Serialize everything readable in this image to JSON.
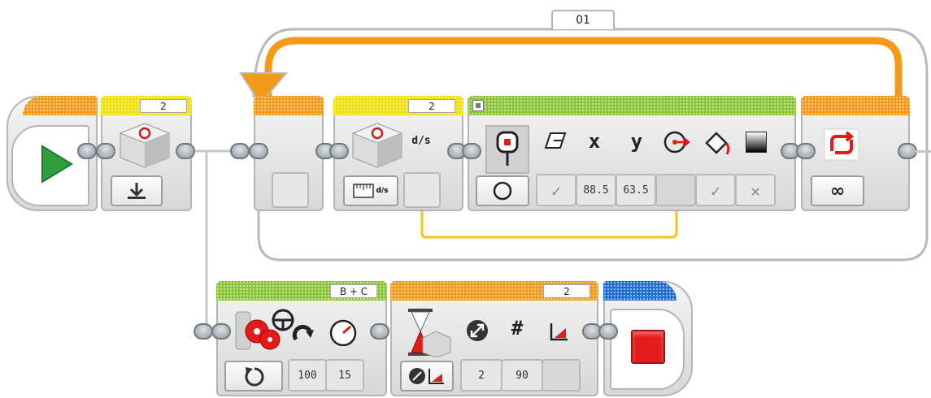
{
  "loop": {
    "name": "01",
    "mode_label": "∞",
    "colors": {
      "header": "#f39a1a",
      "frame": "#b5b5b5",
      "return_arrow": "#f39a1a"
    }
  },
  "timer_reset_block": {
    "port": "2"
  },
  "timer_read_block": {
    "port": "2",
    "unit": "d/s",
    "mode_label": "d/s"
  },
  "display_block": {
    "labels": {
      "x": "x",
      "y": "y"
    },
    "inputs": {
      "clear": "✓",
      "x": "88.5",
      "y": "63.5",
      "fill": "✓",
      "color": "✕"
    },
    "colors": {
      "header": "#8cc43a"
    }
  },
  "move_steering_block": {
    "ports": "B + C",
    "inputs": {
      "power": "100",
      "steering": "15"
    },
    "colors": {
      "header": "#8cc43a"
    }
  },
  "wait_block": {
    "port": "2",
    "inputs": {
      "compare_type": "2",
      "threshold": "90"
    },
    "symbols": {
      "number": "#"
    },
    "colors": {
      "header": "#f39a1a"
    }
  },
  "stop_block": {
    "colors": {
      "header": "#1f6ed1",
      "stop": "#e21b1b"
    }
  },
  "colors": {
    "data_wire": "#f4c419",
    "sequence_wire": "#c7c7c7",
    "start": "#2e9e3e"
  }
}
